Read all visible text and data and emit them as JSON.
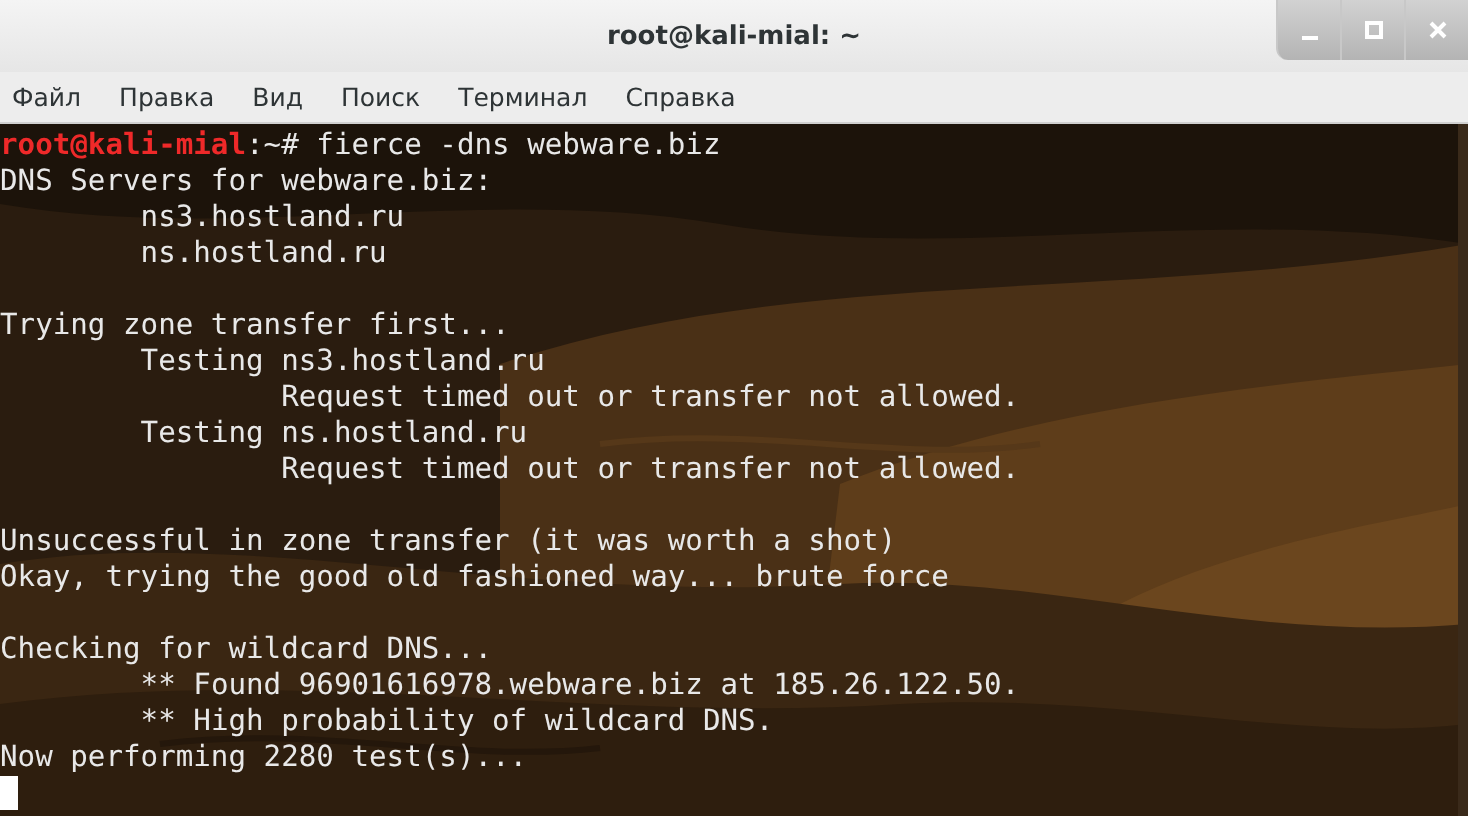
{
  "window": {
    "title": "root@kali-mial: ~"
  },
  "menu": [
    "Файл",
    "Правка",
    "Вид",
    "Поиск",
    "Терминал",
    "Справка"
  ],
  "terminal": {
    "lines": [
      {
        "kind": "prompt",
        "user_host": "root@kali-mial",
        "path": ":~#",
        "command": "fierce -dns webware.biz"
      },
      {
        "kind": "output",
        "text": "DNS Servers for webware.biz:"
      },
      {
        "kind": "output",
        "text": "\tns3.hostland.ru"
      },
      {
        "kind": "output",
        "text": "\tns.hostland.ru"
      },
      {
        "kind": "blank"
      },
      {
        "kind": "output",
        "text": "Trying zone transfer first..."
      },
      {
        "kind": "output",
        "text": "\tTesting ns3.hostland.ru"
      },
      {
        "kind": "output",
        "text": "\t\tRequest timed out or transfer not allowed."
      },
      {
        "kind": "output",
        "text": "\tTesting ns.hostland.ru"
      },
      {
        "kind": "output",
        "text": "\t\tRequest timed out or transfer not allowed."
      },
      {
        "kind": "blank"
      },
      {
        "kind": "output",
        "text": "Unsuccessful in zone transfer (it was worth a shot)"
      },
      {
        "kind": "output",
        "text": "Okay, trying the good old fashioned way... brute force"
      },
      {
        "kind": "blank"
      },
      {
        "kind": "output",
        "text": "Checking for wildcard DNS..."
      },
      {
        "kind": "output",
        "text": "\t** Found 96901616978.webware.biz at 185.26.122.50."
      },
      {
        "kind": "output",
        "text": "\t** High probability of wildcard DNS."
      },
      {
        "kind": "output",
        "text": "Now performing 2280 test(s)..."
      },
      {
        "kind": "cursor"
      }
    ]
  }
}
